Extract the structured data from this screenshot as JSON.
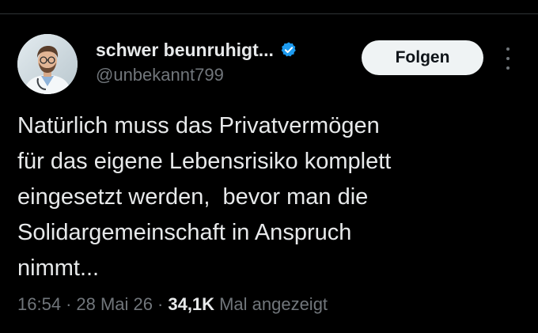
{
  "author": {
    "display_name": "schwer beunruhigt...",
    "handle": "@unbekannt799",
    "verified": true
  },
  "follow_button": {
    "label": "Folgen"
  },
  "tweet": {
    "lines": [
      "Natürlich muss das Privatvermögen",
      "für das eigene Lebensrisiko komplett",
      "eingesetzt werden,  bevor man die",
      "Solidargemeinschaft in Anspruch",
      "nimmt..."
    ]
  },
  "meta": {
    "time": "16:54",
    "separator": "·",
    "date": "28 Mai 26",
    "views_count": "34,1K",
    "views_label": "Mal angezeigt"
  },
  "icons": {
    "verified": "verified-badge-icon",
    "more": "more-vertical-icon"
  },
  "colors": {
    "background": "#000000",
    "text_primary": "#e7e9ea",
    "text_secondary": "#71767b",
    "verified_blue": "#1d9bf0",
    "follow_bg": "#eff3f4"
  }
}
